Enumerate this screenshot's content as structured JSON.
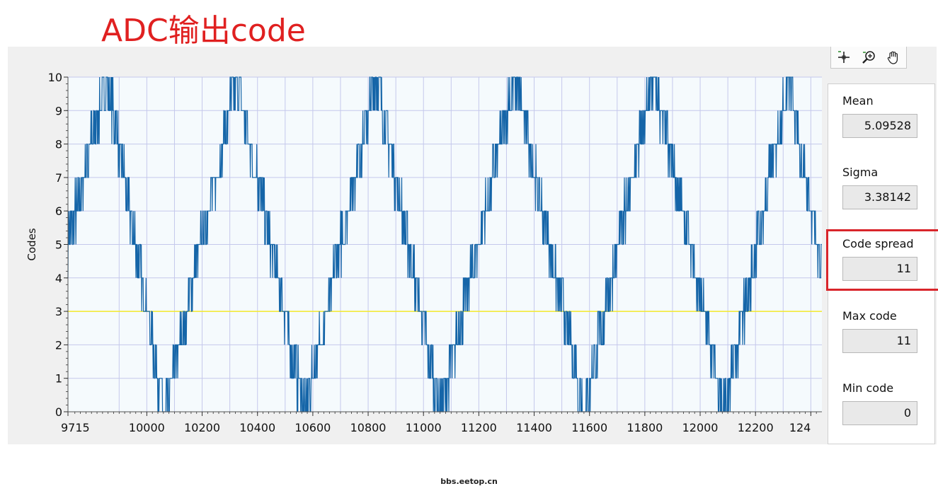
{
  "page_title": "ADC输出code",
  "toolbar": {
    "icons": [
      "crosshair-icon",
      "zoom-icon",
      "pan-hand-icon"
    ]
  },
  "stats": {
    "mean": {
      "label": "Mean",
      "value": "5.09528"
    },
    "sigma": {
      "label": "Sigma",
      "value": "3.38142"
    },
    "code_spread": {
      "label": "Code spread",
      "value": "11"
    },
    "max_code": {
      "label": "Max code",
      "value": "11"
    },
    "min_code": {
      "label": "Min code",
      "value": "0"
    }
  },
  "watermark": "bbs.eetop.cn",
  "colors": {
    "signal": "#1565a8",
    "threshold": "#f4ea2a",
    "grid": "#c5c8ec",
    "plot_bg": "#f5fafd",
    "title": "#e02020",
    "highlight": "#d9252b"
  },
  "chart_data": {
    "type": "line",
    "title": "",
    "xlabel": "",
    "ylabel": "Codes",
    "xlim": [
      9715,
      12440
    ],
    "ylim": [
      0,
      10
    ],
    "x_ticks": [
      9715,
      10000,
      10200,
      10400,
      10600,
      10800,
      11000,
      11200,
      11400,
      11600,
      11800,
      12000,
      12200
    ],
    "x_tick_labels": [
      "9715",
      "10000",
      "10200",
      "10400",
      "10600",
      "10800",
      "11000",
      "11200",
      "11400",
      "11600",
      "11800",
      "12000",
      "12200",
      "124"
    ],
    "y_ticks": [
      0,
      1,
      2,
      3,
      4,
      5,
      6,
      7,
      8,
      9,
      10
    ],
    "grid": true,
    "reference_line": {
      "y": 3
    },
    "series": [
      {
        "description": "noisy sampled triangle-like wave of ADC codes",
        "peaks_x": [
          9855,
          10325,
          10830,
          11330,
          11830,
          12320
        ],
        "troughs_x": [
          10065,
          10570,
          11060,
          11580,
          12090
        ],
        "peak_value": 10,
        "trough_value": 0,
        "start": {
          "x": 9715,
          "y": 5
        },
        "end": {
          "x": 12440,
          "y": 4
        }
      }
    ]
  }
}
